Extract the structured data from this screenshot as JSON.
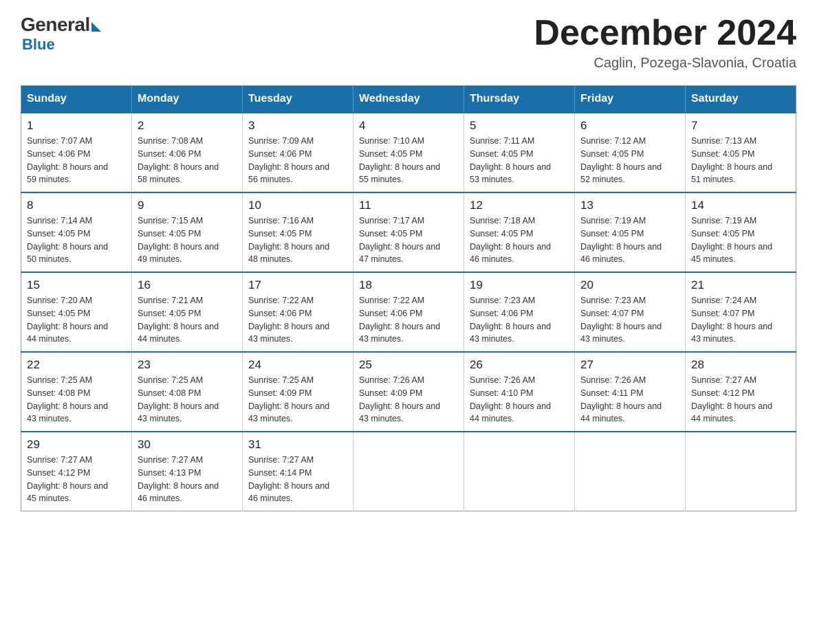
{
  "logo": {
    "general": "General",
    "blue": "Blue"
  },
  "header": {
    "month": "December 2024",
    "location": "Caglin, Pozega-Slavonia, Croatia"
  },
  "days_of_week": [
    "Sunday",
    "Monday",
    "Tuesday",
    "Wednesday",
    "Thursday",
    "Friday",
    "Saturday"
  ],
  "weeks": [
    [
      {
        "day": "1",
        "sunrise": "7:07 AM",
        "sunset": "4:06 PM",
        "daylight": "8 hours and 59 minutes."
      },
      {
        "day": "2",
        "sunrise": "7:08 AM",
        "sunset": "4:06 PM",
        "daylight": "8 hours and 58 minutes."
      },
      {
        "day": "3",
        "sunrise": "7:09 AM",
        "sunset": "4:06 PM",
        "daylight": "8 hours and 56 minutes."
      },
      {
        "day": "4",
        "sunrise": "7:10 AM",
        "sunset": "4:05 PM",
        "daylight": "8 hours and 55 minutes."
      },
      {
        "day": "5",
        "sunrise": "7:11 AM",
        "sunset": "4:05 PM",
        "daylight": "8 hours and 53 minutes."
      },
      {
        "day": "6",
        "sunrise": "7:12 AM",
        "sunset": "4:05 PM",
        "daylight": "8 hours and 52 minutes."
      },
      {
        "day": "7",
        "sunrise": "7:13 AM",
        "sunset": "4:05 PM",
        "daylight": "8 hours and 51 minutes."
      }
    ],
    [
      {
        "day": "8",
        "sunrise": "7:14 AM",
        "sunset": "4:05 PM",
        "daylight": "8 hours and 50 minutes."
      },
      {
        "day": "9",
        "sunrise": "7:15 AM",
        "sunset": "4:05 PM",
        "daylight": "8 hours and 49 minutes."
      },
      {
        "day": "10",
        "sunrise": "7:16 AM",
        "sunset": "4:05 PM",
        "daylight": "8 hours and 48 minutes."
      },
      {
        "day": "11",
        "sunrise": "7:17 AM",
        "sunset": "4:05 PM",
        "daylight": "8 hours and 47 minutes."
      },
      {
        "day": "12",
        "sunrise": "7:18 AM",
        "sunset": "4:05 PM",
        "daylight": "8 hours and 46 minutes."
      },
      {
        "day": "13",
        "sunrise": "7:19 AM",
        "sunset": "4:05 PM",
        "daylight": "8 hours and 46 minutes."
      },
      {
        "day": "14",
        "sunrise": "7:19 AM",
        "sunset": "4:05 PM",
        "daylight": "8 hours and 45 minutes."
      }
    ],
    [
      {
        "day": "15",
        "sunrise": "7:20 AM",
        "sunset": "4:05 PM",
        "daylight": "8 hours and 44 minutes."
      },
      {
        "day": "16",
        "sunrise": "7:21 AM",
        "sunset": "4:05 PM",
        "daylight": "8 hours and 44 minutes."
      },
      {
        "day": "17",
        "sunrise": "7:22 AM",
        "sunset": "4:06 PM",
        "daylight": "8 hours and 43 minutes."
      },
      {
        "day": "18",
        "sunrise": "7:22 AM",
        "sunset": "4:06 PM",
        "daylight": "8 hours and 43 minutes."
      },
      {
        "day": "19",
        "sunrise": "7:23 AM",
        "sunset": "4:06 PM",
        "daylight": "8 hours and 43 minutes."
      },
      {
        "day": "20",
        "sunrise": "7:23 AM",
        "sunset": "4:07 PM",
        "daylight": "8 hours and 43 minutes."
      },
      {
        "day": "21",
        "sunrise": "7:24 AM",
        "sunset": "4:07 PM",
        "daylight": "8 hours and 43 minutes."
      }
    ],
    [
      {
        "day": "22",
        "sunrise": "7:25 AM",
        "sunset": "4:08 PM",
        "daylight": "8 hours and 43 minutes."
      },
      {
        "day": "23",
        "sunrise": "7:25 AM",
        "sunset": "4:08 PM",
        "daylight": "8 hours and 43 minutes."
      },
      {
        "day": "24",
        "sunrise": "7:25 AM",
        "sunset": "4:09 PM",
        "daylight": "8 hours and 43 minutes."
      },
      {
        "day": "25",
        "sunrise": "7:26 AM",
        "sunset": "4:09 PM",
        "daylight": "8 hours and 43 minutes."
      },
      {
        "day": "26",
        "sunrise": "7:26 AM",
        "sunset": "4:10 PM",
        "daylight": "8 hours and 44 minutes."
      },
      {
        "day": "27",
        "sunrise": "7:26 AM",
        "sunset": "4:11 PM",
        "daylight": "8 hours and 44 minutes."
      },
      {
        "day": "28",
        "sunrise": "7:27 AM",
        "sunset": "4:12 PM",
        "daylight": "8 hours and 44 minutes."
      }
    ],
    [
      {
        "day": "29",
        "sunrise": "7:27 AM",
        "sunset": "4:12 PM",
        "daylight": "8 hours and 45 minutes."
      },
      {
        "day": "30",
        "sunrise": "7:27 AM",
        "sunset": "4:13 PM",
        "daylight": "8 hours and 46 minutes."
      },
      {
        "day": "31",
        "sunrise": "7:27 AM",
        "sunset": "4:14 PM",
        "daylight": "8 hours and 46 minutes."
      },
      null,
      null,
      null,
      null
    ]
  ]
}
